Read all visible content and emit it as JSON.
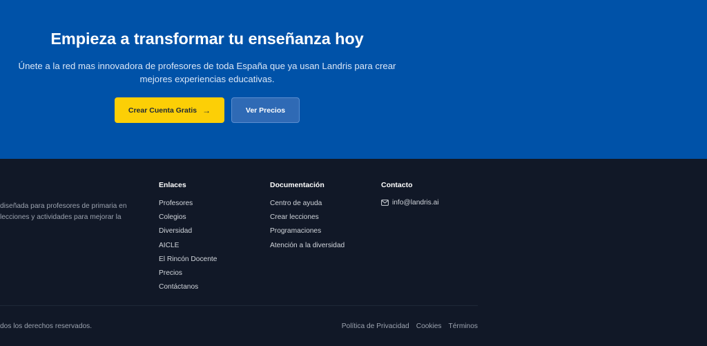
{
  "cta": {
    "title": "Empieza a transformar tu enseñanza hoy",
    "subtitle": "Únete a la red mas innovadora de profesores de toda España que ya usan Landris para crear mejores experiencias educativas.",
    "primary_button": "Crear Cuenta Gratis",
    "primary_arrow": "→",
    "secondary_button": "Ver Precios"
  },
  "footer": {
    "about_lines": [
      "diseñada para profesores de primaria en",
      "lecciones y actividades para mejorar la"
    ],
    "links": {
      "title": "Enlaces",
      "items": [
        "Profesores",
        "Colegios",
        "Diversidad",
        "AICLE",
        "El Rincón Docente",
        "Precios",
        "Contáctanos"
      ]
    },
    "docs": {
      "title": "Documentación",
      "items": [
        "Centro de ayuda",
        "Crear lecciones",
        "Programaciones",
        "Atención a la diversidad"
      ]
    },
    "contact": {
      "title": "Contacto",
      "email": "info@landris.ai",
      "email_icon": "mail-icon"
    },
    "copyright": "dos los derechos reservados.",
    "legal": [
      "Política de Privacidad",
      "Cookies",
      "Términos"
    ]
  },
  "colors": {
    "hero_bg": "#0052a8",
    "footer_bg": "#111827",
    "primary_button": "#fccf06",
    "secondary_button": "#2f6ab5"
  }
}
